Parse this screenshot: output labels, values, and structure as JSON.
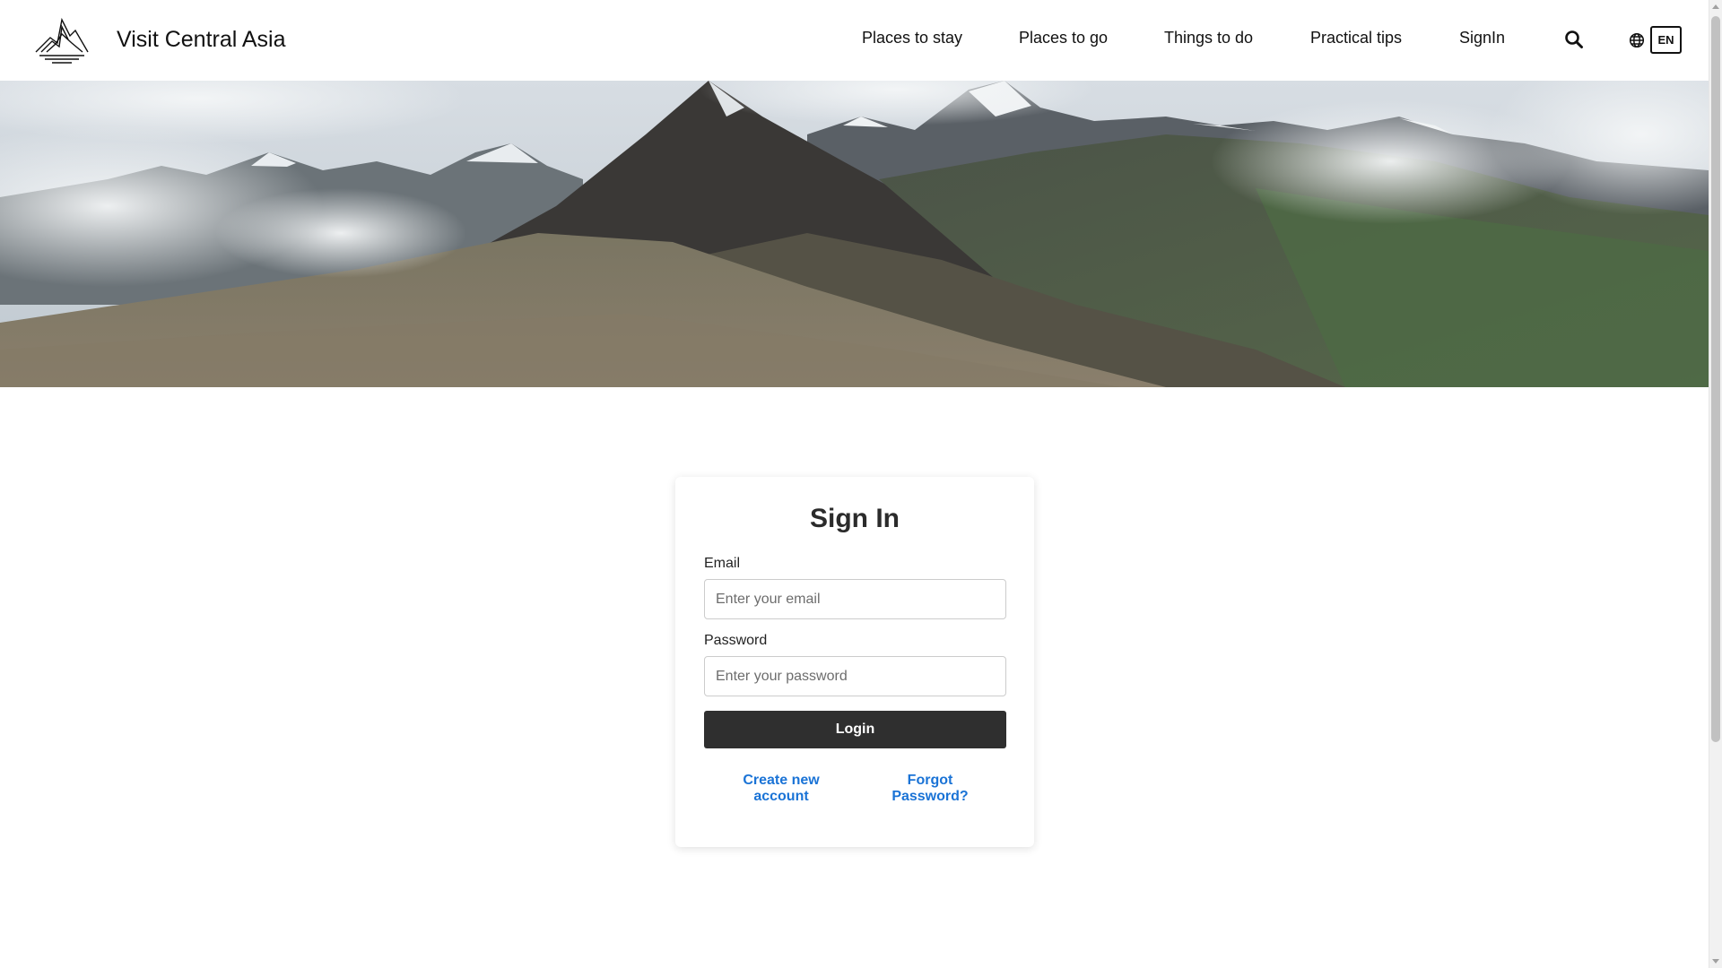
{
  "header": {
    "brand_name": "Visit Central Asia",
    "nav": [
      {
        "label": "Places to stay"
      },
      {
        "label": "Places to go"
      },
      {
        "label": "Things to do"
      },
      {
        "label": "Practical tips"
      },
      {
        "label": "SignIn"
      }
    ],
    "search_icon": "search-icon",
    "language": {
      "icon": "globe-icon",
      "code": "EN"
    }
  },
  "hero": {
    "description": "mountain-landscape-banner"
  },
  "signin": {
    "title": "Sign In",
    "email": {
      "label": "Email",
      "placeholder": "Enter your email",
      "value": ""
    },
    "password": {
      "label": "Password",
      "placeholder": "Enter your password",
      "value": ""
    },
    "login_label": "Login",
    "create_account_label": "Create new account",
    "forgot_password_label": "Forgot Password?"
  },
  "colors": {
    "link": "#1a73d6",
    "button": "#2f2f2f",
    "text": "#111111"
  }
}
